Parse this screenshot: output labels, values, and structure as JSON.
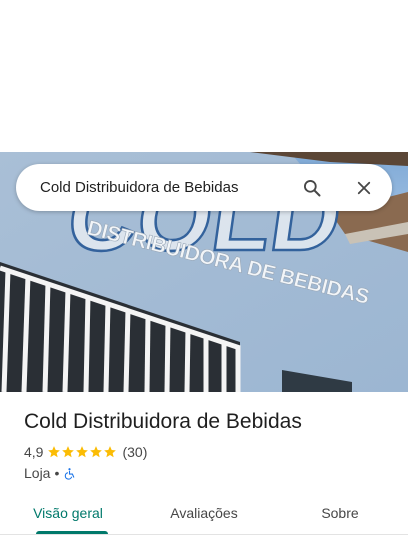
{
  "search": {
    "query": "Cold Distribuidora de Bebidas"
  },
  "hero_image": {
    "sign_line1": "COLD",
    "sign_line2": "DISTRIBUIDORA DE BEBIDAS"
  },
  "place": {
    "name": "Cold Distribuidora de Bebidas",
    "rating": "4,9",
    "stars": 5,
    "reviews": "(30)",
    "category": "Loja",
    "separator": "•"
  },
  "tabs": [
    {
      "label": "Visão geral",
      "active": true
    },
    {
      "label": "Avaliações",
      "active": false
    },
    {
      "label": "Sobre",
      "active": false
    }
  ],
  "colors": {
    "accent": "#00796b",
    "star": "#fbbc04",
    "accessibility": "#1a73e8"
  },
  "icons": {
    "search": "search-icon",
    "close": "close-icon",
    "accessibility": "wheelchair-icon"
  }
}
